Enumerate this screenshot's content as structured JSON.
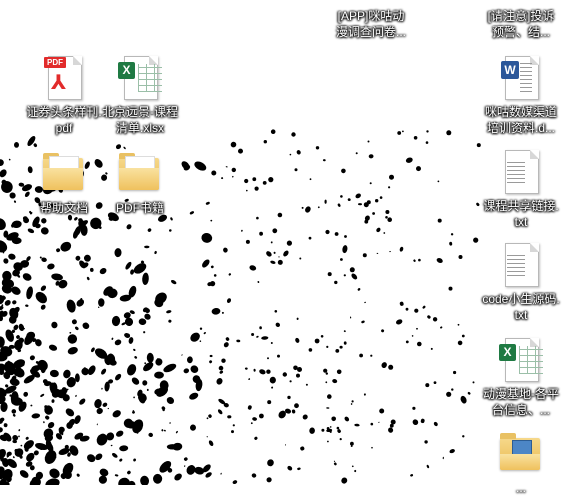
{
  "desktop": {
    "icons": [
      {
        "id": "pdf-securities",
        "label": "证券头条样刊.pdf"
      },
      {
        "id": "xlsx-beijing",
        "label": "北京远景-课程清单.xlsx"
      },
      {
        "id": "folder-help",
        "label": "帮助文档"
      },
      {
        "id": "folder-pdf-books",
        "label": "PDF书籍"
      },
      {
        "id": "app-top",
        "label": "[APP]咪咕动漫调查问卷..."
      },
      {
        "id": "app-right-top",
        "label": "[请注意]投诉预警、结..."
      },
      {
        "id": "docx-migu",
        "label": "咪咕数媒渠道培训资料.d..."
      },
      {
        "id": "txt-course-share",
        "label": "课程共享链接.txt"
      },
      {
        "id": "txt-code",
        "label": "code小生源码.txt"
      },
      {
        "id": "xlsx-anime",
        "label": "动漫基地-各平台信息、..."
      },
      {
        "id": "folder-bottom",
        "label": "..."
      }
    ]
  },
  "colors": {
    "background": "#ffffff",
    "splash": "#000000",
    "label_text": "#ffffff",
    "pdf_red": "#e22b2b",
    "excel_green": "#1f7a43",
    "word_blue": "#2b579a"
  },
  "text": {
    "pdf_tag": "PDF",
    "pdf_mark": "⅄",
    "excel_badge": "X",
    "word_badge": "W"
  }
}
